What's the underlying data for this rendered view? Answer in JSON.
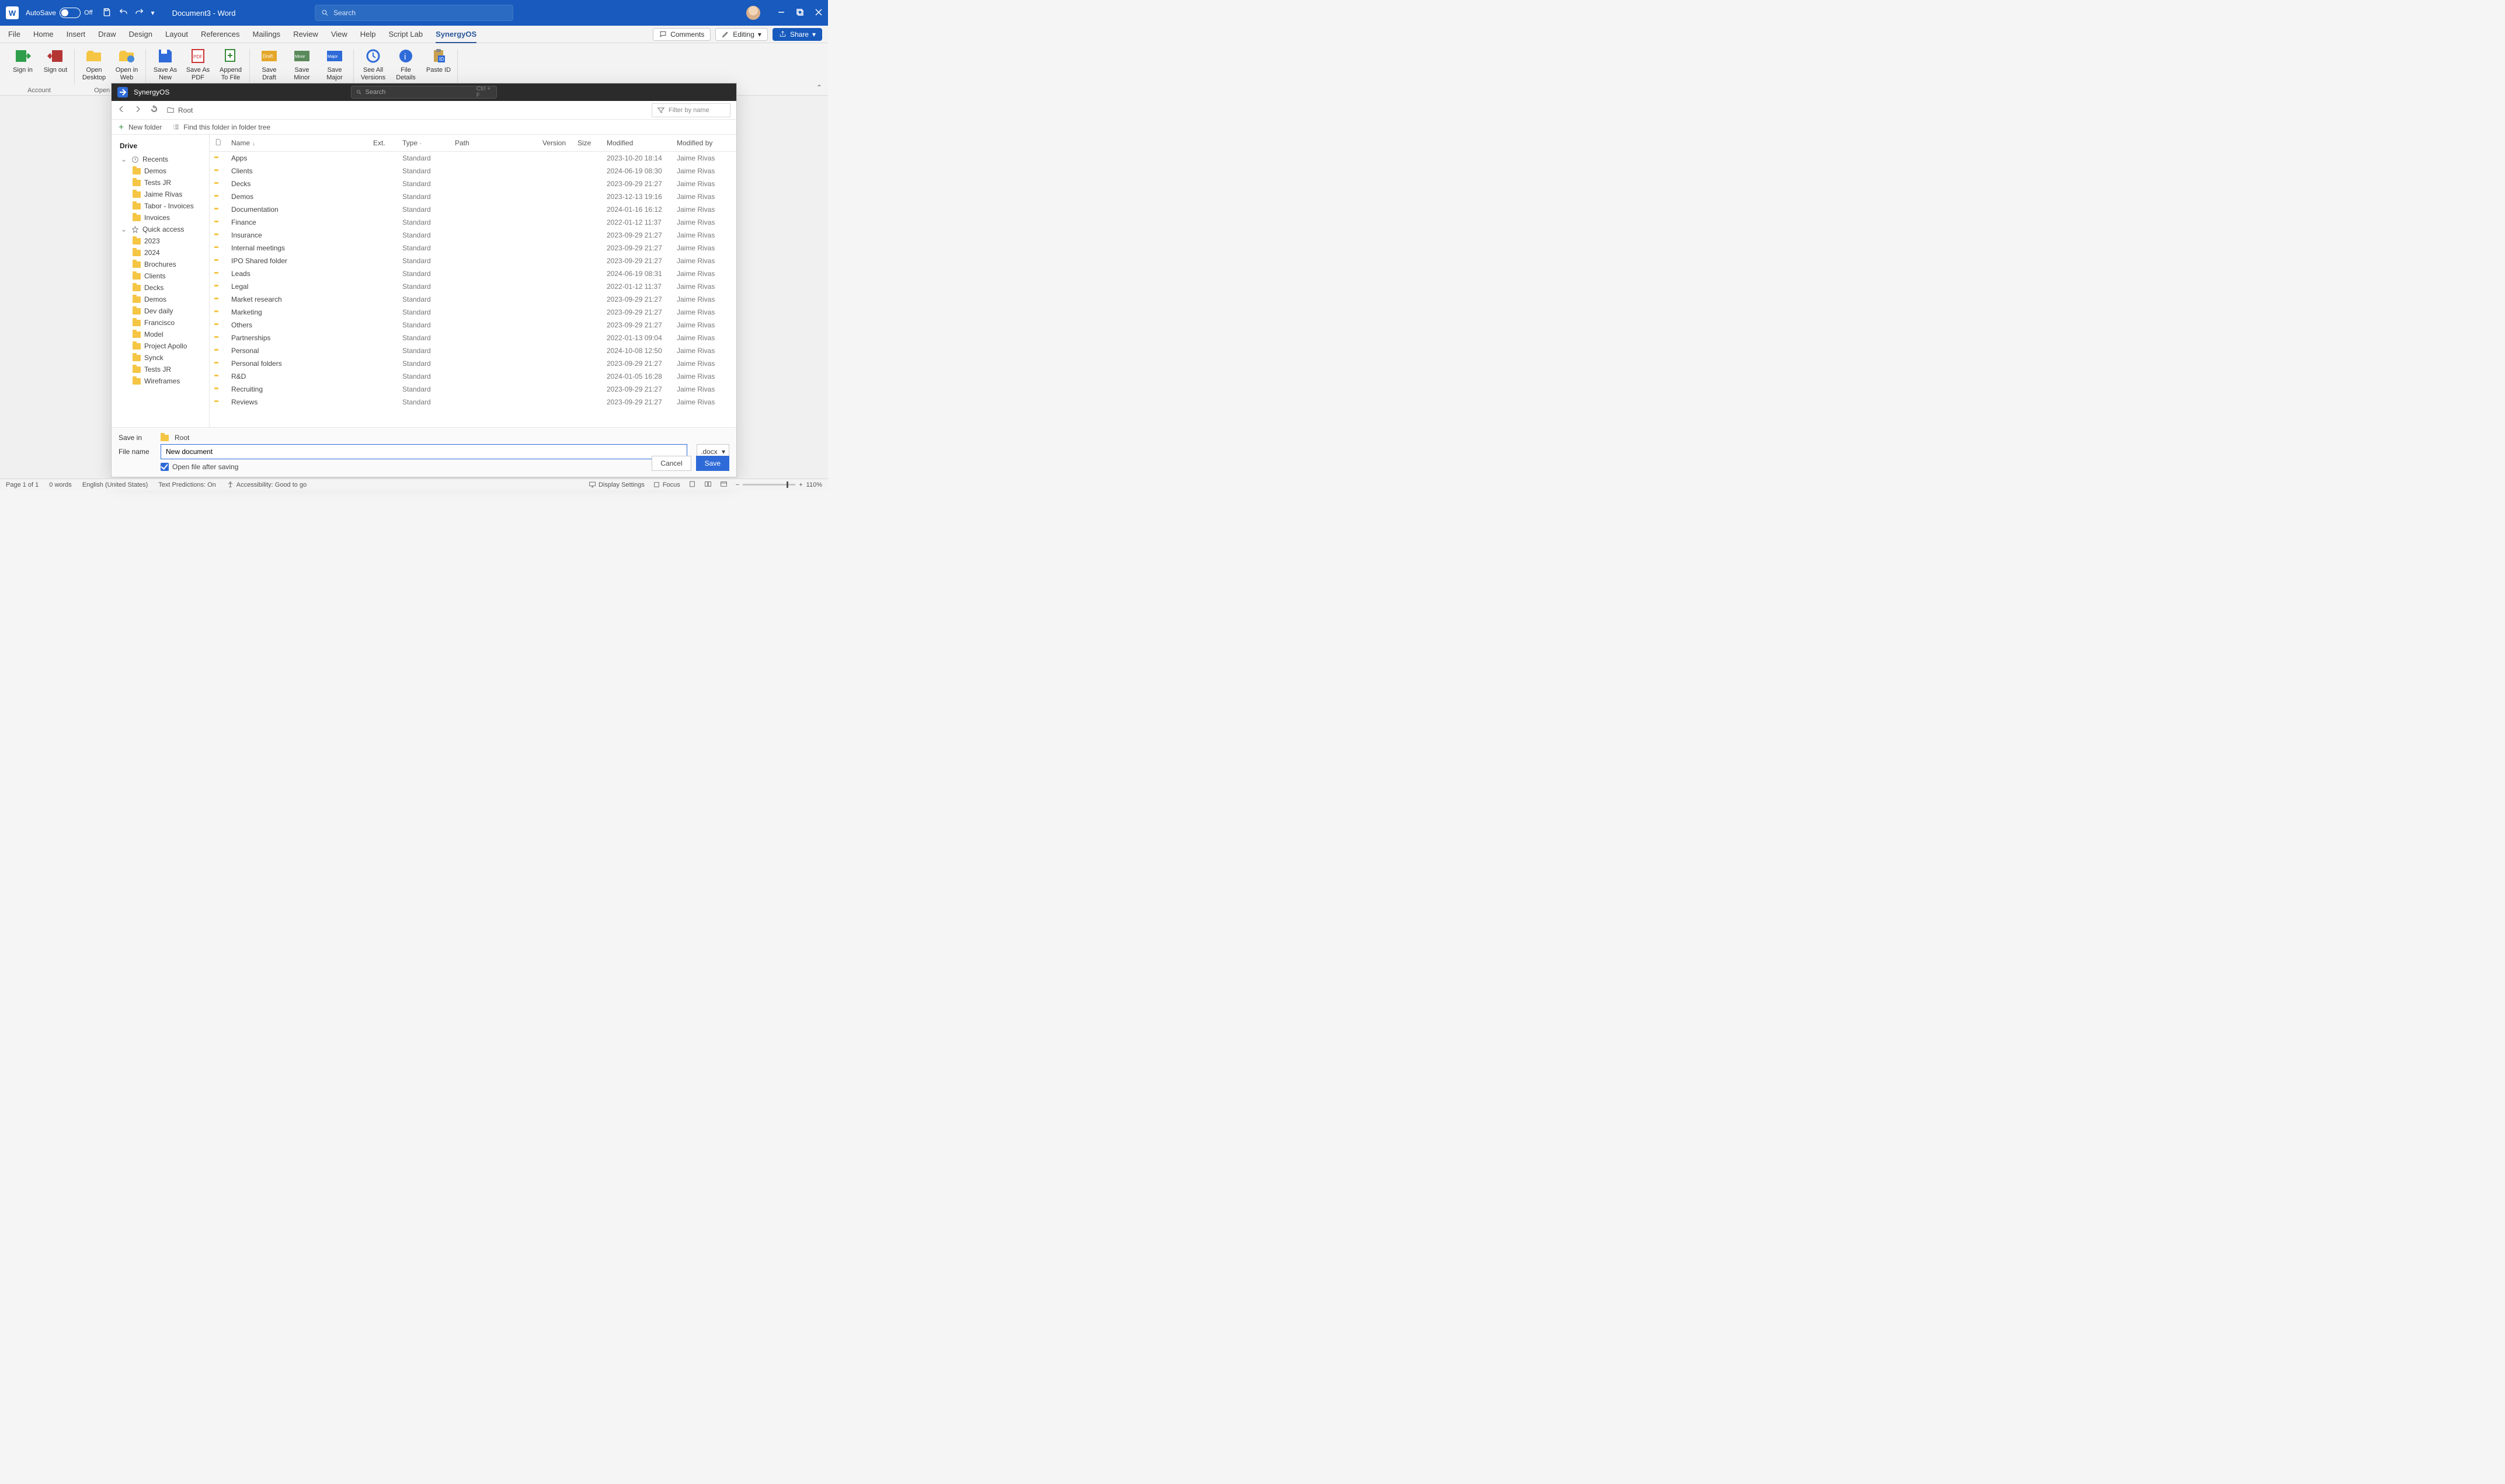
{
  "titlebar": {
    "autosave_label": "AutoSave",
    "autosave_state": "Off",
    "doc_title": "Document3 - Word",
    "search_placeholder": "Search"
  },
  "ribbon_tabs": {
    "file": "File",
    "home": "Home",
    "insert": "Insert",
    "draw": "Draw",
    "design": "Design",
    "layout": "Layout",
    "references": "References",
    "mailings": "Mailings",
    "review": "Review",
    "view": "View",
    "help": "Help",
    "scriptlab": "Script Lab",
    "synergy": "SynergyOS"
  },
  "ribbon_right": {
    "comments": "Comments",
    "editing": "Editing",
    "share": "Share"
  },
  "ribbon": {
    "account": {
      "signin": "Sign in",
      "signout": "Sign out",
      "group": "Account"
    },
    "opendrive": {
      "open_desktop": "Open Desktop",
      "open_web": "Open in Web",
      "group": "Open Drive"
    },
    "save": {
      "save_new": "Save As New",
      "save_pdf": "Save As PDF",
      "append": "Append To File"
    },
    "save2": {
      "draft": "Save Draft",
      "minor": "Save Minor",
      "major": "Save Major"
    },
    "other": {
      "versions": "See All Versions",
      "details": "File Details",
      "paste": "Paste ID"
    }
  },
  "dialog": {
    "app_name": "SynergyOS",
    "search_placeholder": "Search",
    "search_hint": "Ctrl + F",
    "breadcrumb": "Root",
    "filter_placeholder": "Filter by name",
    "new_folder": "New folder",
    "find_tree": "Find this folder in folder tree",
    "sidebar_title": "Drive",
    "recents": "Recents",
    "quick_access": "Quick access",
    "recents_items": [
      "Demos",
      "Tests JR",
      "Jaime Rivas",
      "Tabor - Invoices",
      "Invoices"
    ],
    "quick_items": [
      "2023",
      "2024",
      "Brochures",
      "Clients",
      "Decks",
      "Demos",
      "Dev daily",
      "Francisco",
      "Model",
      "Project Apollo",
      "Synck",
      "Tests JR",
      "Wireframes"
    ],
    "columns": {
      "name": "Name",
      "ext": "Ext.",
      "type": "Type",
      "path": "Path",
      "version": "Version",
      "size": "Size",
      "modified": "Modified",
      "modified_by": "Modified by"
    },
    "rows": [
      {
        "name": "Apps",
        "type": "Standard",
        "modified": "2023-10-20 18:14",
        "by": "Jaime Rivas"
      },
      {
        "name": "Clients",
        "type": "Standard",
        "modified": "2024-06-19 08:30",
        "by": "Jaime Rivas"
      },
      {
        "name": "Decks",
        "type": "Standard",
        "modified": "2023-09-29 21:27",
        "by": "Jaime Rivas"
      },
      {
        "name": "Demos",
        "type": "Standard",
        "modified": "2023-12-13 19:16",
        "by": "Jaime Rivas"
      },
      {
        "name": "Documentation",
        "type": "Standard",
        "modified": "2024-01-16 16:12",
        "by": "Jaime Rivas"
      },
      {
        "name": "Finance",
        "type": "Standard",
        "modified": "2022-01-12 11:37",
        "by": "Jaime Rivas"
      },
      {
        "name": "Insurance",
        "type": "Standard",
        "modified": "2023-09-29 21:27",
        "by": "Jaime Rivas"
      },
      {
        "name": "Internal meetings",
        "type": "Standard",
        "modified": "2023-09-29 21:27",
        "by": "Jaime Rivas"
      },
      {
        "name": "IPO Shared folder",
        "type": "Standard",
        "modified": "2023-09-29 21:27",
        "by": "Jaime Rivas"
      },
      {
        "name": "Leads",
        "type": "Standard",
        "modified": "2024-06-19 08:31",
        "by": "Jaime Rivas"
      },
      {
        "name": "Legal",
        "type": "Standard",
        "modified": "2022-01-12 11:37",
        "by": "Jaime Rivas"
      },
      {
        "name": "Market research",
        "type": "Standard",
        "modified": "2023-09-29 21:27",
        "by": "Jaime Rivas"
      },
      {
        "name": "Marketing",
        "type": "Standard",
        "modified": "2023-09-29 21:27",
        "by": "Jaime Rivas"
      },
      {
        "name": "Others",
        "type": "Standard",
        "modified": "2023-09-29 21:27",
        "by": "Jaime Rivas"
      },
      {
        "name": "Partnerships",
        "type": "Standard",
        "modified": "2022-01-13 09:04",
        "by": "Jaime Rivas"
      },
      {
        "name": "Personal",
        "type": "Standard",
        "modified": "2024-10-08 12:50",
        "by": "Jaime Rivas"
      },
      {
        "name": "Personal folders",
        "type": "Standard",
        "modified": "2023-09-29 21:27",
        "by": "Jaime Rivas"
      },
      {
        "name": "R&D",
        "type": "Standard",
        "modified": "2024-01-05 16:28",
        "by": "Jaime Rivas"
      },
      {
        "name": "Recruiting",
        "type": "Standard",
        "modified": "2023-09-29 21:27",
        "by": "Jaime Rivas"
      },
      {
        "name": "Reviews",
        "type": "Standard",
        "modified": "2023-09-29 21:27",
        "by": "Jaime Rivas"
      }
    ],
    "footer": {
      "save_in_lbl": "Save in",
      "save_in_val": "Root",
      "file_name_lbl": "File name",
      "file_name_val": "New document",
      "ext": ".docx",
      "open_after": "Open file after saving",
      "cancel": "Cancel",
      "save": "Save"
    }
  },
  "statusbar": {
    "page": "Page 1 of 1",
    "words": "0 words",
    "lang": "English (United States)",
    "predictions": "Text Predictions: On",
    "accessibility": "Accessibility: Good to go",
    "display": "Display Settings",
    "focus": "Focus",
    "zoom": "110%"
  }
}
